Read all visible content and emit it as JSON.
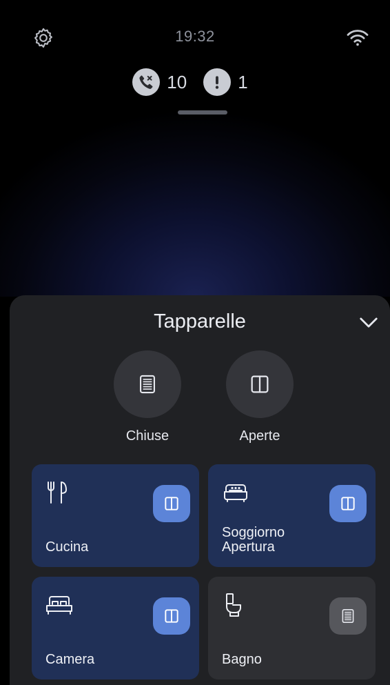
{
  "status": {
    "time": "19:32",
    "missed_calls_count": "10",
    "alerts_count": "1"
  },
  "sheet": {
    "title": "Tapparelle",
    "quick_actions": [
      {
        "label": "Chiuse",
        "icon": "closed-blind-icon"
      },
      {
        "label": "Aperte",
        "icon": "open-blind-icon"
      }
    ]
  },
  "rooms": [
    {
      "name": "Cucina",
      "subtitle": "",
      "icon": "fork-knife-icon",
      "state": "open"
    },
    {
      "name": "Soggiorno",
      "subtitle": "Apertura",
      "icon": "sofa-icon",
      "state": "open"
    },
    {
      "name": "Camera",
      "subtitle": "",
      "icon": "bed-icon",
      "state": "open"
    },
    {
      "name": "Bagno",
      "subtitle": "",
      "icon": "toilet-icon",
      "state": "closed"
    }
  ],
  "colors": {
    "tile_active": "#203057",
    "tile_inactive": "#2e2f33",
    "toggle_active": "#5c84d8",
    "toggle_inactive": "#56575c",
    "sheet_bg": "#202124"
  }
}
